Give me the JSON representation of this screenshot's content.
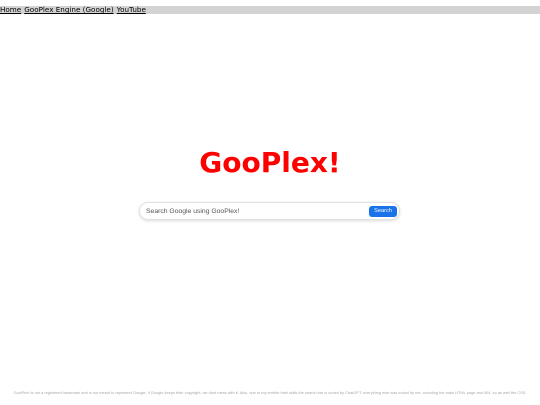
{
  "nav": {
    "links": [
      {
        "label": "Home"
      },
      {
        "label": "GooPlex Engine (Google)"
      },
      {
        "label": "YouTube"
      }
    ]
  },
  "logo": {
    "text": "GooPlex!",
    "color": "#ff0000"
  },
  "search": {
    "placeholder": "Search Google using GooPlex!",
    "button_label": "Search",
    "button_color": "#1a73e8"
  },
  "footer": {
    "text": "GooPlex! is not a registered trademark and is not meant to represent Google. If Google keeps their copyright, we dont mess with it. Also, due to my terrible html skills the search bar is coded by ChatGPT. everything else was coded by me, including the main HTML page and 404, so as well the CSS."
  }
}
